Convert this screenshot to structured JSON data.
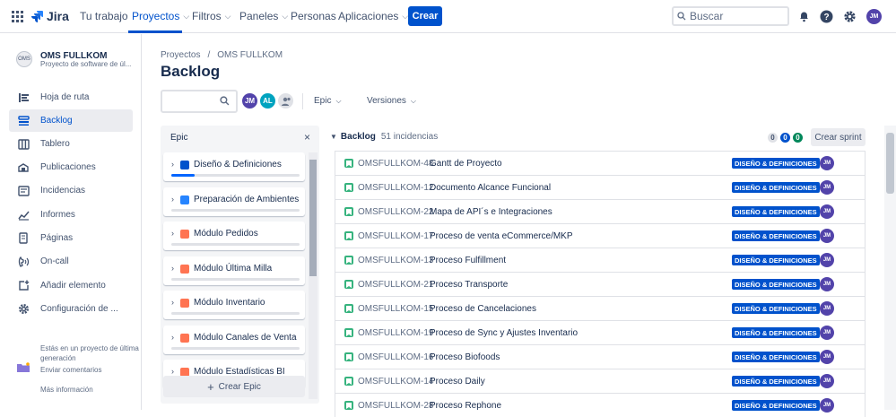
{
  "app": {
    "logo_text": "Jira",
    "brand_color": "#0052cc"
  },
  "topnav": {
    "items": [
      {
        "label": "Tu trabajo",
        "has_chevron": false
      },
      {
        "label": "Proyectos",
        "has_chevron": true,
        "active": true
      },
      {
        "label": "Filtros",
        "has_chevron": true
      },
      {
        "label": "Paneles",
        "has_chevron": true
      },
      {
        "label": "Personas",
        "has_chevron": false
      },
      {
        "label": "Aplicaciones",
        "has_chevron": true
      }
    ],
    "create_label": "Crear",
    "search_placeholder": "Buscar",
    "user_initials": "JM"
  },
  "sidebar": {
    "project_name": "OMS FULLKOM",
    "project_sub": "Proyecto de software de úl...",
    "project_icon_text": "OMS",
    "items": [
      {
        "label": "Hoja de ruta",
        "icon": "roadmap-icon"
      },
      {
        "label": "Backlog",
        "icon": "backlog-icon",
        "active": true
      },
      {
        "label": "Tablero",
        "icon": "board-icon"
      },
      {
        "label": "Publicaciones",
        "icon": "releases-icon"
      },
      {
        "label": "Incidencias",
        "icon": "issues-icon"
      },
      {
        "label": "Informes",
        "icon": "reports-icon"
      },
      {
        "label": "Páginas",
        "icon": "pages-icon"
      },
      {
        "label": "On-call",
        "icon": "on-call-icon"
      },
      {
        "label": "Añadir elemento",
        "icon": "add-item-icon"
      },
      {
        "label": "Configuración de ...",
        "icon": "settings-icon"
      }
    ],
    "footer_text": "Estás en un proyecto de última generación",
    "feedback_label": "Enviar comentarios",
    "more_info_label": "Más información"
  },
  "main": {
    "breadcrumb": [
      "Proyectos",
      "/",
      "OMS FULLKOM"
    ],
    "title": "Backlog",
    "avatars": [
      {
        "initials": "JM",
        "color": "#5243aa"
      },
      {
        "initials": "AL",
        "color": "#00a3bf"
      }
    ],
    "filters": [
      {
        "label": "Epic"
      },
      {
        "label": "Versiones"
      }
    ]
  },
  "epic_panel": {
    "title": "Epic",
    "close": "×",
    "create_label": "Crear Epic",
    "epics": [
      {
        "name": "Diseño & Definiciones",
        "color": "#0052cc",
        "progress": 0.18
      },
      {
        "name": "Preparación de Ambientes",
        "color": "#2684ff",
        "progress": 0
      },
      {
        "name": "Módulo Pedidos",
        "color": "#ff7452",
        "progress": 0
      },
      {
        "name": "Módulo Última Milla",
        "color": "#ff7452",
        "progress": 0
      },
      {
        "name": "Módulo Inventario",
        "color": "#ff7452",
        "progress": 0
      },
      {
        "name": "Módulo Canales de Venta",
        "color": "#ff7452",
        "progress": 0
      },
      {
        "name": "Módulo Estadísticas BI",
        "color": "#ff7452",
        "progress": 0
      }
    ]
  },
  "backlog": {
    "title": "Backlog",
    "count": "51 incidencias",
    "pills": [
      {
        "value": "0",
        "bg": "#dfe1e6",
        "fg": "#42526e"
      },
      {
        "value": "0",
        "bg": "#0052cc",
        "fg": "#ffffff"
      },
      {
        "value": "0",
        "bg": "#00875a",
        "fg": "#ffffff"
      }
    ],
    "create_sprint_label": "Crear sprint",
    "issues": [
      {
        "key": "OMSFULLKOM-48",
        "summary": "Gantt de Proyecto",
        "epic": "DISEÑO & DEFINICIONES",
        "assignee": "JM"
      },
      {
        "key": "OMSFULLKOM-12",
        "summary": "Documento Alcance Funcional",
        "epic": "DISEÑO & DEFINICIONES",
        "assignee": "JM"
      },
      {
        "key": "OMSFULLKOM-22",
        "summary": "Mapa de API´s e Integraciones",
        "epic": "DISEÑO & DEFINICIONES",
        "assignee": "JM"
      },
      {
        "key": "OMSFULLKOM-17",
        "summary": "Proceso de venta eCommerce/MKP",
        "epic": "DISEÑO & DEFINICIONES",
        "assignee": "JM"
      },
      {
        "key": "OMSFULLKOM-13",
        "summary": "Proceso Fulfillment",
        "epic": "DISEÑO & DEFINICIONES",
        "assignee": "JM"
      },
      {
        "key": "OMSFULLKOM-21",
        "summary": "Proceso Transporte",
        "epic": "DISEÑO & DEFINICIONES",
        "assignee": "JM"
      },
      {
        "key": "OMSFULLKOM-15",
        "summary": "Proceso de Cancelaciones",
        "epic": "DISEÑO & DEFINICIONES",
        "assignee": "JM"
      },
      {
        "key": "OMSFULLKOM-19",
        "summary": "Proceso de Sync y Ajustes Inventario",
        "epic": "DISEÑO & DEFINICIONES",
        "assignee": "JM"
      },
      {
        "key": "OMSFULLKOM-16",
        "summary": "Proceso Biofoods",
        "epic": "DISEÑO & DEFINICIONES",
        "assignee": "JM"
      },
      {
        "key": "OMSFULLKOM-14",
        "summary": "Proceso Daily",
        "epic": "DISEÑO & DEFINICIONES",
        "assignee": "JM"
      },
      {
        "key": "OMSFULLKOM-28",
        "summary": "Proceso Rephone",
        "epic": "DISEÑO & DEFINICIONES",
        "assignee": "JM"
      }
    ]
  }
}
